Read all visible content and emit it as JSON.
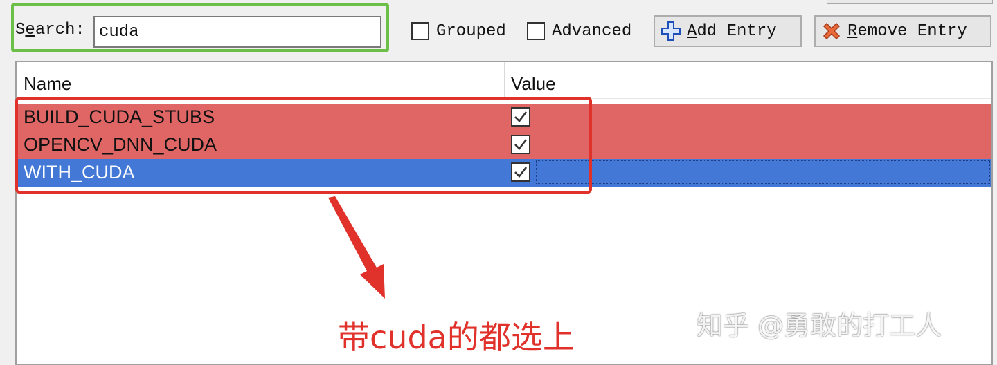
{
  "toolbar": {
    "search_label_prefix": "S",
    "search_label_underlined": "e",
    "search_label_suffix": "arch:",
    "search_value": "cuda",
    "grouped_label": "Grouped",
    "advanced_label": "Advanced",
    "add_entry_underlined": "A",
    "add_entry_rest": "dd Entry",
    "remove_entry_underlined": "R",
    "remove_entry_rest": "emove Entry"
  },
  "table": {
    "columns": [
      "Name",
      "Value"
    ],
    "rows": [
      {
        "name": "BUILD_CUDA_STUBS",
        "checked": true,
        "state": "red"
      },
      {
        "name": "OPENCV_DNN_CUDA",
        "checked": true,
        "state": "red"
      },
      {
        "name": "WITH_CUDA",
        "checked": true,
        "state": "selected"
      }
    ]
  },
  "annotation": {
    "text": "带cuda的都选上"
  },
  "watermark": {
    "text": "知乎 @勇敢的打工人"
  },
  "colors": {
    "search_highlight": "#6cc04a",
    "annotation_red": "#e0312a",
    "row_red": "#e06666",
    "row_selected": "#4378d6"
  },
  "icons": {
    "add": "plus-cross-icon",
    "remove": "x-cross-icon",
    "annotation": "arrow-down-icon"
  }
}
